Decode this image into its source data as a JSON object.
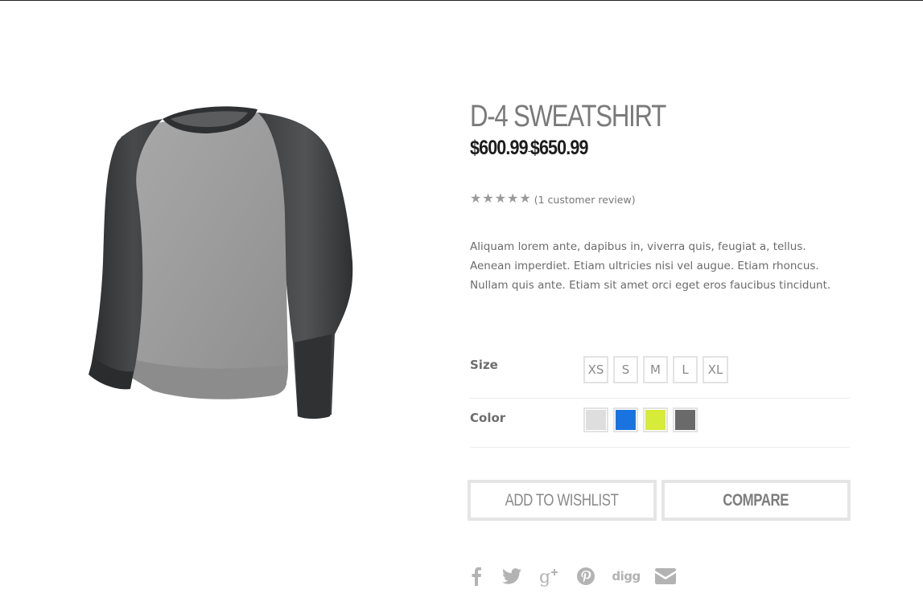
{
  "product": {
    "title": "D-4 SWEATSHIRT",
    "price_min": "$600.99",
    "price_sep": "-",
    "price_max": "$650.99",
    "rating": {
      "stars": 5,
      "max": 5,
      "review_text": "(1 customer review)"
    },
    "description": "Aliquam lorem ante, dapibus in, viverra quis, feugiat a, tellus. Aenean imperdiet. Etiam ultricies nisi vel augue. Etiam rhoncus. Nullam quis ante. Etiam sit amet orci eget eros faucibus tincidunt."
  },
  "options": {
    "size": {
      "label": "Size",
      "values": [
        "XS",
        "S",
        "M",
        "L",
        "XL"
      ]
    },
    "color": {
      "label": "Color",
      "swatches": [
        {
          "name": "light-gray",
          "hex": "#dedede"
        },
        {
          "name": "blue",
          "hex": "#1a74e0"
        },
        {
          "name": "lime",
          "hex": "#d6eb3a"
        },
        {
          "name": "dark-gray",
          "hex": "#6a6a6a"
        }
      ]
    }
  },
  "actions": {
    "wishlist_label": "ADD TO WISHLIST",
    "compare_label": "COMPARE"
  },
  "share": {
    "icons": [
      "facebook-icon",
      "twitter-icon",
      "google-plus-icon",
      "pinterest-icon",
      "digg-icon",
      "email-icon"
    ],
    "digg_text": "digg",
    "icon_color": "#b3b3b3"
  }
}
